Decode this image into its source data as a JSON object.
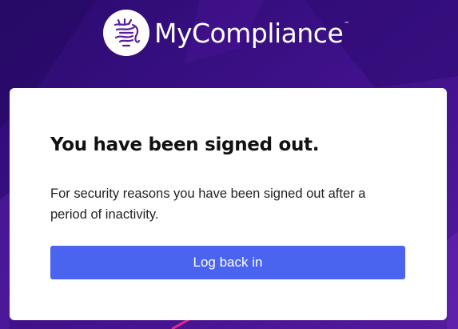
{
  "brand": {
    "name": "MyCompliance",
    "trademark": "™",
    "logo_icon": "mycompliance-logo-icon"
  },
  "card": {
    "title": "You have been signed out.",
    "message": "For security reasons you have been signed out after a period of inactivity.",
    "button_label": "Log back in"
  },
  "colors": {
    "background_dark": "#2a0a6b",
    "background_purple": "#4a1596",
    "accent_magenta": "#e02a8a",
    "logo_purple": "#5a1fa0",
    "button_blue": "#4a64f0",
    "card_bg": "#ffffff"
  }
}
